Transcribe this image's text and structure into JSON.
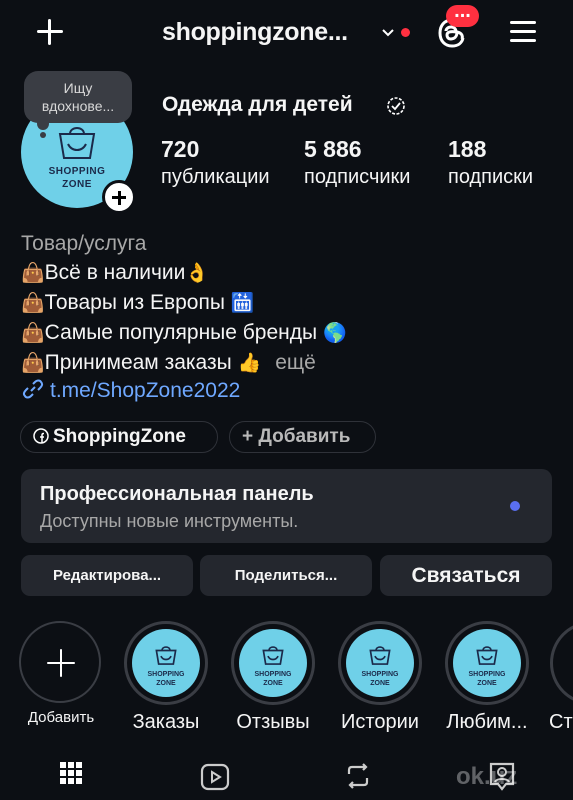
{
  "header": {
    "username": "shoppingzone...",
    "notification_badge": "...",
    "accent_red": "#ff3040"
  },
  "note": {
    "text_line1": "Ищу",
    "text_line2": "вдохнове..."
  },
  "avatar": {
    "logo_line1": "SHOPPING",
    "logo_line2": "ZONE",
    "bg_color": "#6fd0e8"
  },
  "profile": {
    "name": "Одежда для детей",
    "stats": [
      {
        "value": "720",
        "label": "публикации"
      },
      {
        "value": "5 886",
        "label": "подписчики"
      },
      {
        "value": "188",
        "label": "подписки"
      }
    ]
  },
  "bio": {
    "category": "Товар/услуга",
    "lines": [
      {
        "emoji": "👜",
        "text": "Всё в наличии",
        "tail": "👌"
      },
      {
        "emoji": "👜",
        "text": "Товары из Европы ",
        "tail": "🛗"
      },
      {
        "emoji": "👜",
        "text": "Самые популярные бренды ",
        "tail": "🌎"
      },
      {
        "emoji": "👜",
        "text": "Принимеам заказы ",
        "tail": "👍"
      }
    ],
    "more_label": "ещё",
    "link": "t.me/ShopZone2022",
    "link_color": "#6fa8ff"
  },
  "chips": {
    "facebook_label": "ShoppingZone",
    "add_label": "+ Добавить"
  },
  "pro_panel": {
    "title": "Профессиональная панель",
    "subtitle": "Доступны новые инструменты."
  },
  "actions": {
    "edit_label": "Редактирова...",
    "share_label": "Поделиться...",
    "contact_label": "Связаться"
  },
  "highlights": [
    {
      "label": "Добавить"
    },
    {
      "label": "Заказы"
    },
    {
      "label": "Отзывы"
    },
    {
      "label": "Истории"
    },
    {
      "label": "Любим..."
    },
    {
      "label": "Ст"
    }
  ],
  "bottom_tabs": [
    "grid-icon",
    "reels-icon",
    "reposts-icon",
    "tagged-icon"
  ],
  "watermark": "ok.uz"
}
